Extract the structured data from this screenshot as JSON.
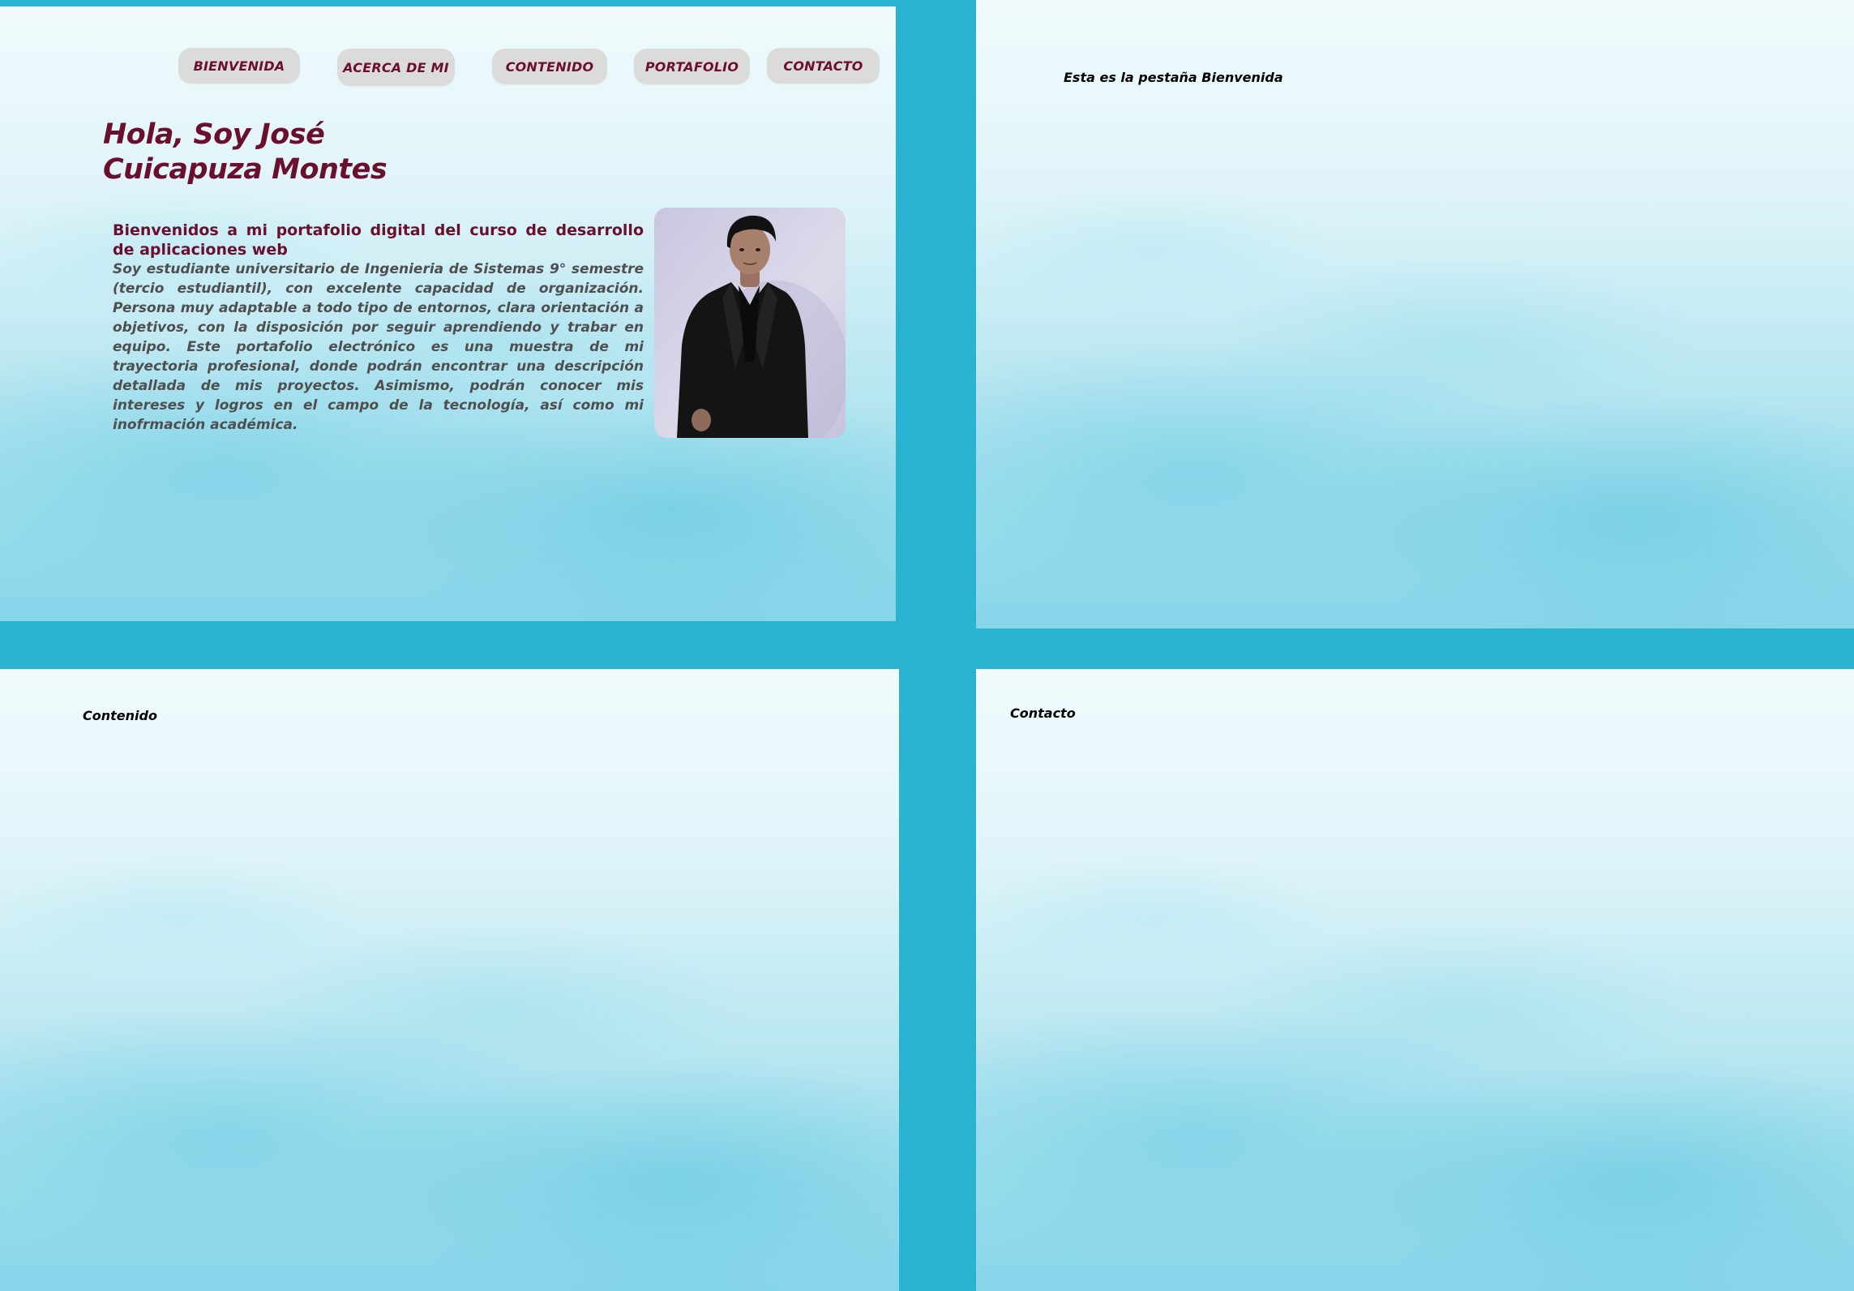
{
  "nav": {
    "items": [
      {
        "label": "BIENVENIDA"
      },
      {
        "label": "ACERCA DE MI"
      },
      {
        "label": "CONTENIDO"
      },
      {
        "label": "PORTAFOLIO"
      },
      {
        "label": "CONTACTO"
      }
    ]
  },
  "hero": {
    "title_line1": "Hola, Soy José",
    "title_line2": "Cuicapuza Montes",
    "intro_heading": "Bienvenidos a mi portafolio digital del curso de desarrollo de aplicaciones web",
    "intro_text": "Soy estudiante universitario de Ingenieria de Sistemas 9° semestre (tercio estudiantil), con excelente capacidad de organización. Persona muy adaptable a todo tipo de entornos, clara orientación a objetivos, con la disposición por seguir aprendiendo y trabar en equipo. Este portafolio electrónico es una muestra de mi trayectoria profesional, donde podrán encontrar una descripción detallada de mis proyectos. Asimismo, podrán conocer mis intereses y logros en el campo de la tecnología, así como mi inofrmación académica."
  },
  "panels": {
    "welcome_label": "Esta es la pestaña Bienvenida",
    "content_label": "Contenido",
    "contact_label": "Contacto"
  },
  "colors": {
    "background": "#2ab3d1",
    "accent": "#6b0f2f",
    "nav_button": "#dcdbdb",
    "body_text": "#4f4f4f"
  }
}
